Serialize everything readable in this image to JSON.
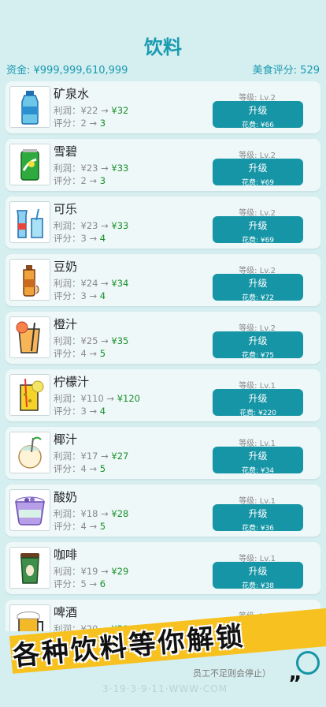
{
  "header": {
    "title": "饮料",
    "funds": "资金: ¥999,999,610,999",
    "food_rating": "美食评分: 529"
  },
  "common": {
    "profit_prefix": "利润：",
    "rating_prefix": "评分：",
    "arrow": " → ",
    "upgrade_label": "升级"
  },
  "items": [
    {
      "name": "矿泉水",
      "icon": "water-bottle-icon",
      "profit_old": "¥22",
      "profit_new": "¥32",
      "rating_old": "2",
      "rating_new": "3",
      "level": "等级: Lv.2",
      "cost": "花费: ¥66"
    },
    {
      "name": "雪碧",
      "icon": "sprite-can-icon",
      "profit_old": "¥23",
      "profit_new": "¥33",
      "rating_old": "2",
      "rating_new": "3",
      "level": "等级: Lv.2",
      "cost": "花费: ¥69"
    },
    {
      "name": "可乐",
      "icon": "cola-icon",
      "profit_old": "¥23",
      "profit_new": "¥33",
      "rating_old": "3",
      "rating_new": "4",
      "level": "等级: Lv.2",
      "cost": "花费: ¥69"
    },
    {
      "name": "豆奶",
      "icon": "soy-milk-icon",
      "profit_old": "¥24",
      "profit_new": "¥34",
      "rating_old": "3",
      "rating_new": "4",
      "level": "等级: Lv.2",
      "cost": "花费: ¥72"
    },
    {
      "name": "橙汁",
      "icon": "orange-juice-icon",
      "profit_old": "¥25",
      "profit_new": "¥35",
      "rating_old": "4",
      "rating_new": "5",
      "level": "等级: Lv.2",
      "cost": "花费: ¥75"
    },
    {
      "name": "柠檬汁",
      "icon": "lemon-juice-icon",
      "profit_old": "¥110",
      "profit_new": "¥120",
      "rating_old": "3",
      "rating_new": "4",
      "level": "等级: Lv.1",
      "cost": "花费: ¥220"
    },
    {
      "name": "椰汁",
      "icon": "coconut-icon",
      "profit_old": "¥17",
      "profit_new": "¥27",
      "rating_old": "4",
      "rating_new": "5",
      "level": "等级: Lv.1",
      "cost": "花费: ¥34"
    },
    {
      "name": "酸奶",
      "icon": "yogurt-icon",
      "profit_old": "¥18",
      "profit_new": "¥28",
      "rating_old": "4",
      "rating_new": "5",
      "level": "等级: Lv.1",
      "cost": "花费: ¥36"
    },
    {
      "name": "咖啡",
      "icon": "coffee-cup-icon",
      "profit_old": "¥19",
      "profit_new": "¥29",
      "rating_old": "5",
      "rating_new": "6",
      "level": "等级: Lv.1",
      "cost": "花费: ¥38"
    },
    {
      "name": "啤酒",
      "icon": "beer-mug-icon",
      "profit_old": "¥20",
      "profit_new": "¥30",
      "rating_old": "",
      "rating_new": "",
      "level": "等级: Lv.1",
      "cost": ""
    }
  ],
  "footer": {
    "hint": "员工不足则会停止）",
    "watermark": "3·19·3·9·11·WWW·COM"
  },
  "banner": {
    "text": "各种饮料等你解锁",
    "quote_mark": "”"
  }
}
